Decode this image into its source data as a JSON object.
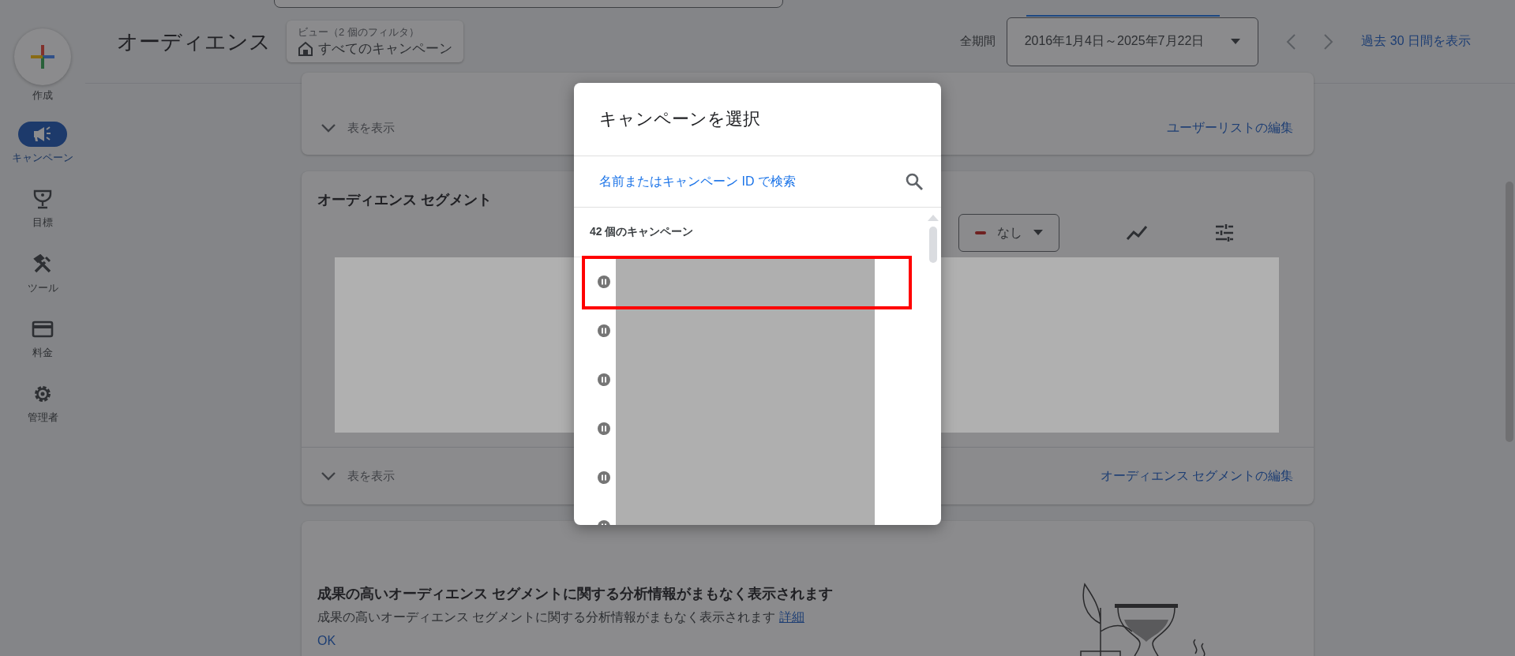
{
  "sidebar": {
    "create_label": "作成",
    "items": [
      {
        "label": "キャンペーン",
        "kind": "megaphone",
        "selected": true
      },
      {
        "label": "目標",
        "kind": "trophy",
        "selected": false
      },
      {
        "label": "ツール",
        "kind": "tools",
        "selected": false
      },
      {
        "label": "料金",
        "kind": "card",
        "selected": false
      },
      {
        "label": "管理者",
        "kind": "gear",
        "selected": false
      }
    ]
  },
  "header": {
    "title": "オーディエンス",
    "view_filter": {
      "caption": "ビュー（2 個のフィルタ）",
      "value": "すべてのキャンペーン"
    },
    "period_label": "全期間",
    "date_range": "2016年1月4日～2025年7月22日",
    "recent_link": "過去 30 日間を表示"
  },
  "user_list_card": {
    "toggle": "表を表示",
    "edit_link": "ユーザーリストの編集"
  },
  "segment_card": {
    "title": "オーディエンス セグメント",
    "filter": "なし",
    "toggle": "表を表示",
    "edit_link": "オーディエンス セグメントの編集"
  },
  "insights_card": {
    "heading": "成果の高いオーディエンス セグメントに関する分析情報がまもなく表示されます",
    "text": "成果の高いオーディエンス セグメントに関する分析情報がまもなく表示されます",
    "link": "詳細",
    "button": "OK"
  },
  "dialog": {
    "title": "キャンペーンを選択",
    "search": {
      "placeholder": "名前またはキャンペーン ID で検索"
    },
    "count": "42 個のキャンペーン",
    "campaigns": [
      {
        "highlighted": true
      },
      {
        "highlighted": false
      },
      {
        "highlighted": false
      },
      {
        "highlighted": false
      },
      {
        "highlighted": false
      },
      {
        "highlighted": false
      }
    ]
  }
}
